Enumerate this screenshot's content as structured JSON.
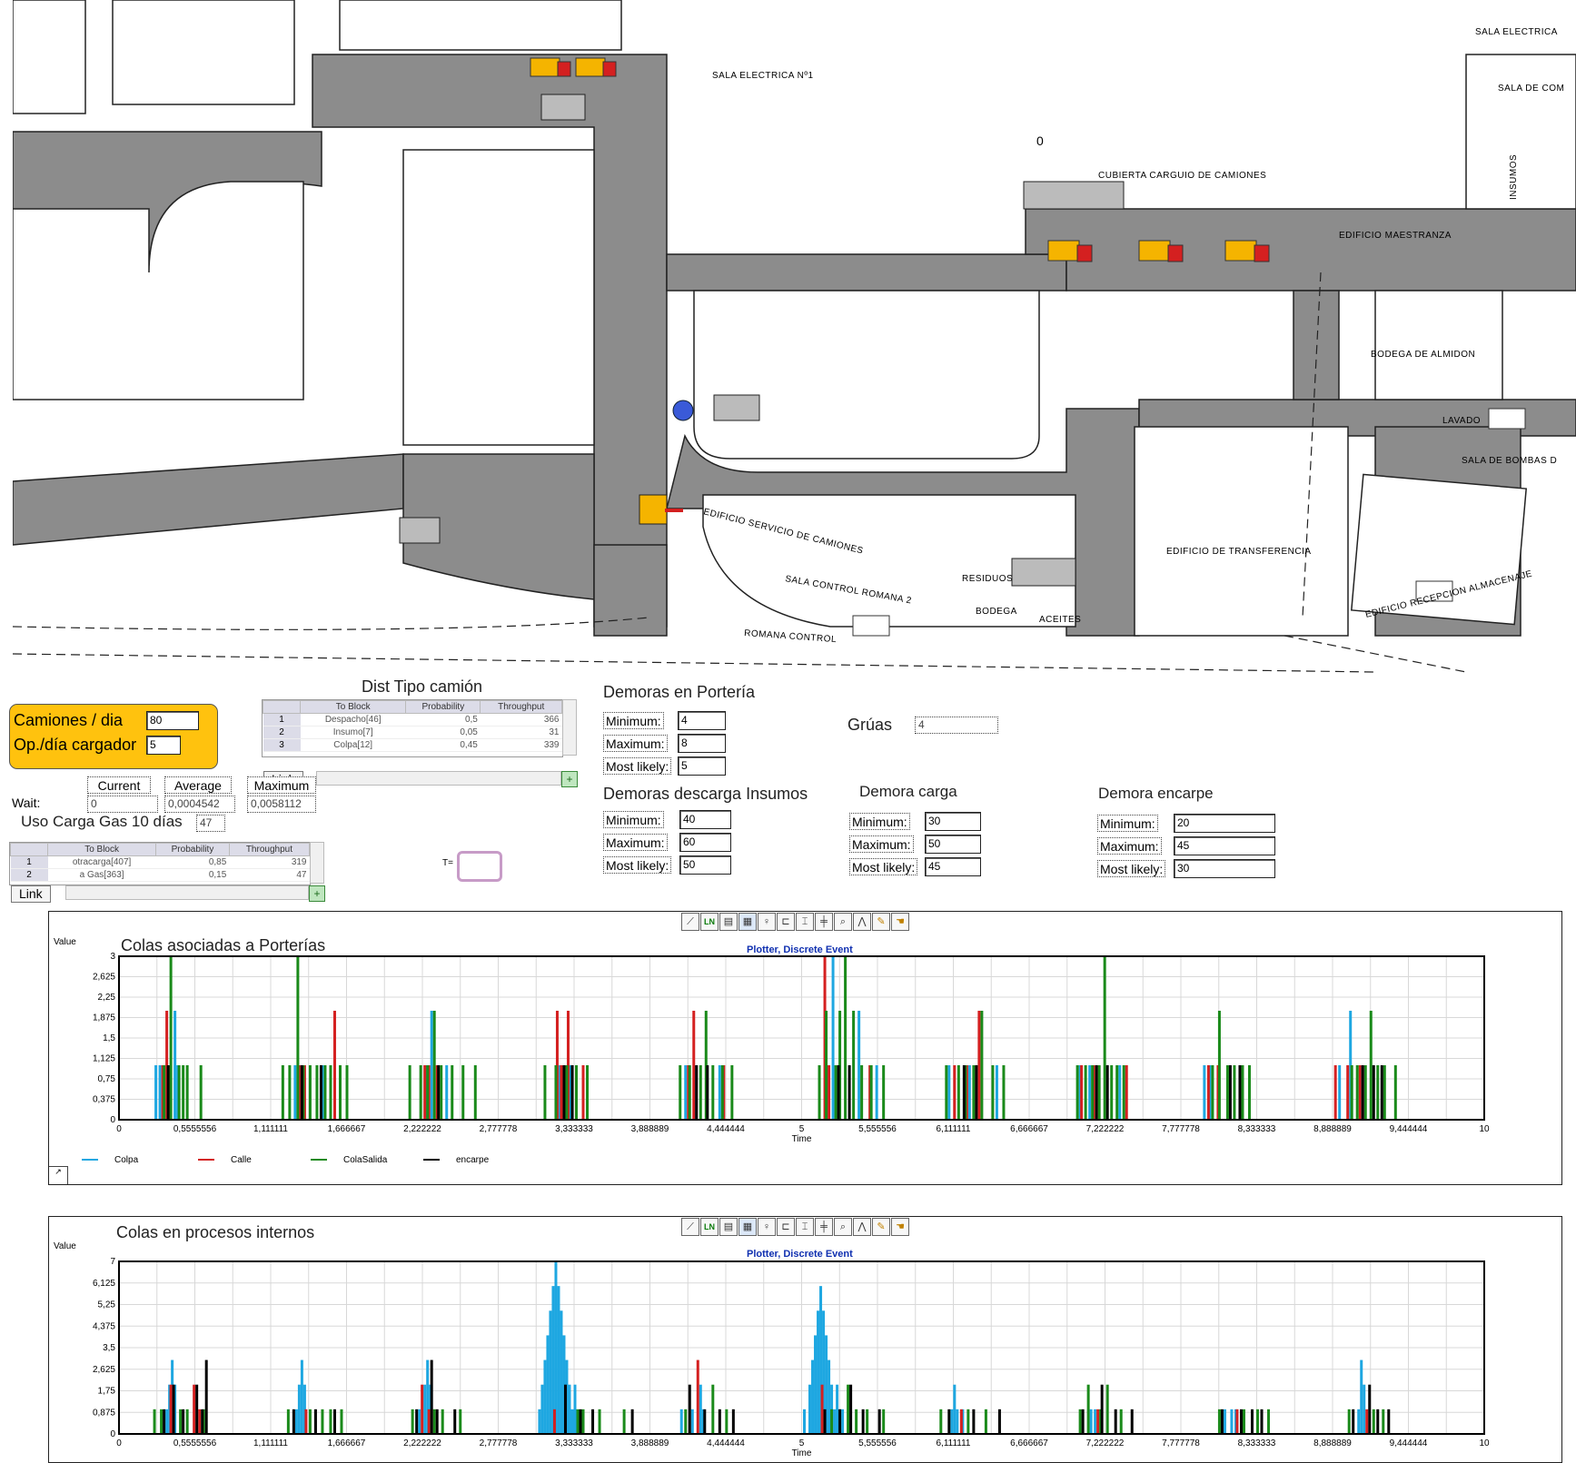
{
  "map": {
    "labels": {
      "sala_electrica_1": "SALA ELECTRICA Nº1",
      "sala_electrica_right": "SALA ELECTRICA",
      "sala_de_com": "SALA DE COM",
      "counter_zero": "0",
      "cubierta": "CUBIERTA CARGUIO DE CAMIONES",
      "insumos": "INSUMOS",
      "edificio_maestranza": "EDIFICIO MAESTRANZA",
      "bodega_almidon": "BODEGA DE ALMIDON",
      "lavado": "LAVADO",
      "sala_bombas": "SALA DE BOMBAS D",
      "edificio_servicio": "EDIFICIO SERVICIO DE CAMIONES",
      "sala_control_romana": "SALA CONTROL ROMANA 2",
      "residuos": "RESIDUOS",
      "bodega": "BODEGA",
      "aceites": "ACEITES",
      "romana_control": "ROMANA CONTROL",
      "edificio_transferencia": "EDIFICIO DE TRANSFERENCIA",
      "edificio_recepcion": "EDIFICIO RECEPCION ALMACENAJE"
    }
  },
  "panel": {
    "camiones_label": "Camiones / dia",
    "camiones_value": "80",
    "op_label": "Op./día cargador",
    "op_value": "5"
  },
  "dist_tipo": {
    "title": "Dist Tipo camión",
    "headers": [
      "To Block",
      "Probability",
      "Throughput"
    ],
    "rows": [
      {
        "idx": "1",
        "block": "Despacho[46]",
        "prob": "0,5",
        "thr": "366"
      },
      {
        "idx": "2",
        "block": "Insumo[7]",
        "prob": "0,05",
        "thr": "31"
      },
      {
        "idx": "3",
        "block": "Colpa[12]",
        "prob": "0,45",
        "thr": "339"
      }
    ],
    "link": "Link"
  },
  "wait": {
    "label": "Wait:",
    "headers": [
      "Current",
      "Average",
      "Maximum"
    ],
    "current": "0",
    "average": "0,0004542",
    "maximum": "0,0058112"
  },
  "uso_carga": {
    "label": "Uso Carga Gas 10 días",
    "value": "47"
  },
  "dist_gas": {
    "headers": [
      "To Block",
      "Probability",
      "Throughput"
    ],
    "rows": [
      {
        "idx": "1",
        "block": "otracarga[407]",
        "prob": "0,85",
        "thr": "319"
      },
      {
        "idx": "2",
        "block": "a Gas[363]",
        "prob": "0,15",
        "thr": "47"
      }
    ],
    "link": "Link"
  },
  "t_label": "T=",
  "porteria": {
    "title": "Demoras en Portería",
    "min_label": "Minimum:",
    "min": "4",
    "max_label": "Maximum:",
    "max": "8",
    "ml_label": "Most likely:",
    "ml": "5"
  },
  "gruas": {
    "label": "Grúas",
    "value": "4"
  },
  "insumos": {
    "title": "Demoras descarga Insumos",
    "min_label": "Minimum:",
    "min": "40",
    "max_label": "Maximum:",
    "max": "60",
    "ml_label": "Most likely:",
    "ml": "50"
  },
  "carga": {
    "title": "Demora carga",
    "min_label": "Minimum:",
    "min": "30",
    "max_label": "Maximum:",
    "max": "50",
    "ml_label": "Most likely:",
    "ml": "45"
  },
  "encarpe": {
    "title": "Demora encarpe",
    "min_label": "Minimum:",
    "min": "20",
    "max_label": "Maximum:",
    "max": "45",
    "ml_label": "Most likely:",
    "ml": "30"
  },
  "colors": {
    "colpa": "#1ea7e1",
    "calle": "#d42020",
    "colasalida": "#1a8a1a",
    "encarpe": "#000000",
    "panel": "#ffc20e"
  },
  "toolbar_icons": [
    "line-plot-icon",
    "ln-icon",
    "table-icon",
    "grid-icon",
    "pin-icon",
    "axis-icon",
    "axis-i-icon",
    "axis-cross-icon",
    "zoom-icon",
    "cursor-icon",
    "pen-icon",
    "hand-icon"
  ],
  "chart_data": [
    {
      "type": "bar",
      "title": "Colas asociadas a  Porterías",
      "subtitle": "Plotter, Discrete Event",
      "ylabel": "Value",
      "xlabel": "Time",
      "xlim": [
        0,
        10
      ],
      "ylim": [
        0,
        3
      ],
      "x_ticks": [
        "0",
        "0,5555556",
        "1,111111",
        "1,666667",
        "2,222222",
        "2,777778",
        "3,333333",
        "3,888889",
        "4,444444",
        "5",
        "5,555556",
        "6,111111",
        "6,666667",
        "7,222222",
        "7,777778",
        "8,333333",
        "8,888889",
        "9,444444",
        "10"
      ],
      "y_ticks": [
        "0",
        "0,375",
        "0,75",
        "1,125",
        "1,5",
        "1,875",
        "2,25",
        "2,625",
        "3"
      ],
      "grid": true,
      "legend_position": "bottom-left",
      "series": [
        {
          "name": "Colpa",
          "x": [
            0.27,
            0.3,
            0.41,
            0.43,
            1.29,
            1.33,
            1.49,
            2.25,
            2.29,
            2.4,
            3.23,
            3.3,
            4.15,
            4.22,
            4.4,
            5.19,
            5.23,
            5.42,
            5.55,
            6.08,
            6.23,
            6.43,
            7.04,
            7.11,
            7.33,
            7.95,
            7.99,
            8.94,
            9.02,
            9.1
          ],
          "y": [
            1,
            1,
            2,
            1,
            1,
            1,
            1,
            1,
            2,
            1,
            1,
            1,
            1,
            1,
            1,
            1,
            3,
            2,
            1,
            1,
            1,
            1,
            1,
            1,
            1,
            1,
            1,
            1,
            2,
            1
          ]
        },
        {
          "name": "Calle",
          "x": [
            0.32,
            0.35,
            0.37,
            1.32,
            1.36,
            1.58,
            2.24,
            2.27,
            2.33,
            3.21,
            3.24,
            3.29,
            3.4,
            4.17,
            4.21,
            4.43,
            5.17,
            5.2,
            5.5,
            6.12,
            6.21,
            6.3,
            7.05,
            7.14,
            7.38,
            7.98,
            8.05,
            8.91,
            9.0,
            9.09
          ],
          "y": [
            1,
            2,
            1,
            1,
            1,
            2,
            1,
            1,
            1,
            2,
            1,
            2,
            1,
            1,
            2,
            1,
            3,
            1,
            1,
            1,
            1,
            2,
            1,
            1,
            1,
            1,
            1,
            1,
            1,
            1
          ]
        },
        {
          "name": "ColaSalida",
          "x": [
            0.33,
            0.38,
            0.44,
            0.47,
            0.5,
            0.6,
            1.2,
            1.25,
            1.31,
            1.35,
            1.4,
            1.45,
            1.51,
            1.55,
            1.62,
            1.67,
            2.13,
            2.21,
            2.26,
            2.31,
            2.36,
            2.44,
            2.52,
            2.61,
            3.12,
            3.2,
            3.28,
            3.35,
            3.43,
            4.11,
            4.18,
            4.26,
            4.3,
            4.35,
            4.42,
            4.49,
            5.13,
            5.18,
            5.25,
            5.28,
            5.32,
            5.38,
            5.44,
            5.51,
            5.6,
            6.06,
            6.15,
            6.2,
            6.26,
            6.32,
            6.4,
            6.48,
            7.02,
            7.08,
            7.13,
            7.18,
            7.22,
            7.27,
            7.31,
            7.36,
            8.01,
            8.06,
            8.12,
            8.17,
            8.23,
            8.28,
            9.03,
            9.07,
            9.13,
            9.17,
            9.22,
            9.27,
            9.35
          ],
          "y": [
            1,
            3,
            1,
            1,
            1,
            1,
            1,
            1,
            3,
            1,
            1,
            1,
            1,
            1,
            1,
            1,
            1,
            1,
            1,
            2,
            1,
            1,
            1,
            1,
            1,
            1,
            1,
            1,
            1,
            1,
            1,
            1,
            2,
            1,
            1,
            1,
            1,
            2,
            1,
            2,
            3,
            2,
            1,
            1,
            1,
            1,
            1,
            1,
            1,
            2,
            1,
            1,
            1,
            1,
            1,
            1,
            3,
            1,
            1,
            1,
            1,
            2,
            1,
            1,
            1,
            1,
            1,
            1,
            1,
            2,
            1,
            1,
            1
          ]
        },
        {
          "name": "encarpe",
          "x": [
            0.36,
            1.34,
            1.48,
            2.34,
            3.26,
            3.32,
            4.23,
            4.31,
            5.27,
            5.35,
            6.19,
            6.28,
            7.16,
            7.24,
            8.14,
            8.21,
            9.11,
            9.19,
            9.25
          ],
          "y": [
            1,
            1,
            1,
            1,
            1,
            1,
            1,
            1,
            1,
            1,
            1,
            1,
            1,
            1,
            1,
            1,
            1,
            1,
            1
          ]
        }
      ]
    },
    {
      "type": "bar",
      "title": "Colas en procesos internos",
      "subtitle": "Plotter, Discrete Event",
      "ylabel": "Value",
      "xlabel": "Time",
      "xlim": [
        0,
        10
      ],
      "ylim": [
        0,
        7
      ],
      "x_ticks": [
        "0",
        "0,5555556",
        "1,111111",
        "1,666667",
        "2,222222",
        "2,777778",
        "3,333333",
        "3,888889",
        "4,444444",
        "5",
        "5,555556",
        "6,111111",
        "6,666667",
        "7,222222",
        "7,777778",
        "8,333333",
        "8,888889",
        "9,444444",
        "10"
      ],
      "y_ticks": [
        "0",
        "0,875",
        "1,75",
        "2,625",
        "3,5",
        "4,375",
        "5,25",
        "6,125",
        "7"
      ],
      "grid": true,
      "series": [
        {
          "name": "Colpa",
          "x": [
            0.35,
            0.37,
            0.39,
            0.41,
            1.3,
            1.32,
            1.34,
            1.36,
            2.2,
            2.24,
            2.26,
            2.28,
            3.08,
            3.1,
            3.12,
            3.14,
            3.16,
            3.18,
            3.2,
            3.22,
            3.24,
            3.26,
            3.28,
            3.3,
            3.32,
            3.34,
            4.12,
            4.2,
            4.26,
            4.28,
            5.02,
            5.06,
            5.08,
            5.1,
            5.12,
            5.14,
            5.16,
            5.18,
            5.2,
            5.22,
            5.24,
            5.26,
            5.28,
            5.3,
            6.1,
            6.12,
            6.14,
            6.18,
            7.12,
            7.15,
            8.1,
            8.15,
            8.18,
            9.08,
            9.1,
            9.12
          ],
          "y": [
            1,
            2,
            3,
            2,
            1,
            2,
            3,
            2,
            1,
            2,
            3,
            2,
            1,
            2,
            3,
            4,
            5,
            6,
            7,
            6,
            5,
            4,
            3,
            2,
            1,
            2,
            1,
            1,
            2,
            1,
            1,
            2,
            3,
            4,
            5,
            6,
            5,
            4,
            3,
            2,
            1,
            2,
            1,
            1,
            1,
            2,
            1,
            1,
            1,
            1,
            1,
            1,
            1,
            1,
            3,
            2
          ]
        },
        {
          "name": "Calle",
          "x": [
            0.38,
            0.55,
            0.59,
            1.37,
            2.22,
            2.27,
            3.19,
            4.24,
            5.15,
            6.17,
            7.17,
            8.19,
            9.14
          ],
          "y": [
            2,
            2,
            1,
            1,
            2,
            1,
            1,
            3,
            2,
            1,
            1,
            1,
            1
          ]
        },
        {
          "name": "ColaSalida",
          "x": [
            0.26,
            0.31,
            0.45,
            0.5,
            0.62,
            1.24,
            1.4,
            1.49,
            1.55,
            1.63,
            2.15,
            2.31,
            2.37,
            2.5,
            3.36,
            3.4,
            3.52,
            3.7,
            4.15,
            4.35,
            4.45,
            5.22,
            5.34,
            5.4,
            5.48,
            5.6,
            6.02,
            6.22,
            6.35,
            7.04,
            7.1,
            7.19,
            7.24,
            7.34,
            8.06,
            8.24,
            8.34,
            8.42,
            9.01,
            9.19,
            9.26
          ],
          "y": [
            1,
            1,
            1,
            1,
            1,
            1,
            1,
            1,
            1,
            1,
            1,
            1,
            1,
            1,
            1,
            1,
            1,
            1,
            1,
            2,
            1,
            1,
            2,
            1,
            1,
            1,
            1,
            1,
            1,
            1,
            2,
            1,
            2,
            1,
            1,
            1,
            1,
            1,
            1,
            1,
            1
          ]
        },
        {
          "name": "encarpe",
          "x": [
            0.33,
            0.4,
            0.47,
            0.57,
            0.61,
            0.64,
            1.28,
            1.44,
            1.58,
            2.18,
            2.29,
            2.33,
            2.46,
            3.27,
            3.38,
            3.47,
            3.76,
            4.18,
            4.29,
            4.4,
            4.5,
            5.17,
            5.28,
            5.36,
            5.45,
            5.57,
            6.08,
            6.26,
            6.45,
            7.06,
            7.2,
            7.3,
            7.42,
            8.08,
            8.22,
            8.3,
            8.37,
            9.04,
            9.16,
            9.22,
            9.3
          ],
          "y": [
            1,
            2,
            1,
            2,
            1,
            3,
            1,
            1,
            1,
            1,
            3,
            1,
            1,
            2,
            1,
            1,
            1,
            2,
            1,
            1,
            1,
            1,
            1,
            2,
            1,
            1,
            1,
            1,
            1,
            1,
            2,
            1,
            1,
            1,
            1,
            1,
            1,
            1,
            2,
            1,
            1
          ]
        }
      ]
    }
  ]
}
